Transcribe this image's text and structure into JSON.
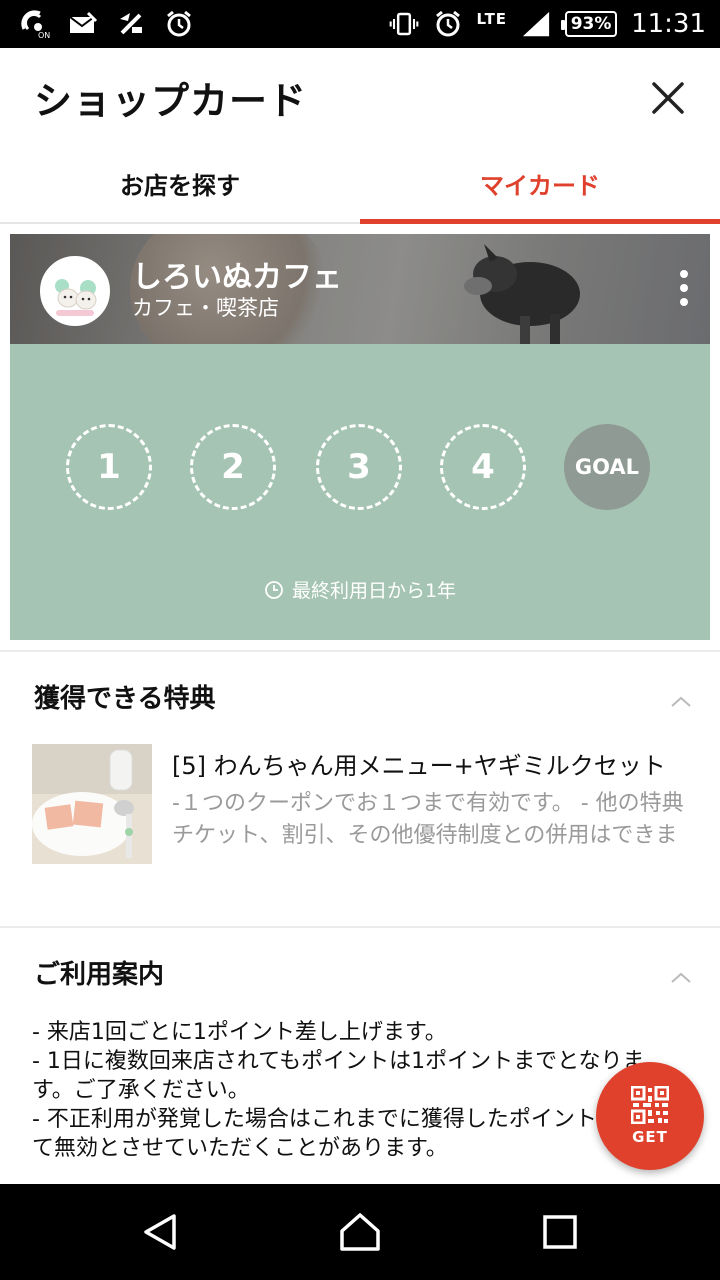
{
  "status_bar": {
    "network": "LTE",
    "battery": "93%",
    "time": "11:31"
  },
  "header": {
    "title": "ショップカード"
  },
  "tabs": [
    {
      "label": "お店を探す",
      "active": false
    },
    {
      "label": "マイカード",
      "active": true
    }
  ],
  "card": {
    "shop_name": "しろいぬカフェ",
    "category": "カフェ・喫茶店",
    "avatar_text": "しろいぬカフェ",
    "stamps": [
      "1",
      "2",
      "3",
      "4"
    ],
    "goal_label": "GOAL",
    "expiry": "最終利用日から1年"
  },
  "benefits": {
    "title": "獲得できる特典",
    "item": {
      "title": "[5] わんちゃん用メニュー+ヤギミルクセット",
      "description": "-１つのクーポンでお１つまで有効です。 - 他の特典チケット、割引、その他優待制度との併用はできません。"
    }
  },
  "guide": {
    "title": "ご利用案内",
    "text": "- 来店1回ごとに1ポイント差し上げます。\n- 1日に複数回来店されてもポイントは1ポイントまでとなります。ご了承ください。\n- 不正利用が発覚した場合はこれまでに獲得したポイント等、全て無効とさせていただくことがあります。"
  },
  "get_button": {
    "label": "GET"
  },
  "colors": {
    "accent": "#e0412c",
    "card_green": "#a5c4b3",
    "goal_gray": "#8f9a94"
  }
}
